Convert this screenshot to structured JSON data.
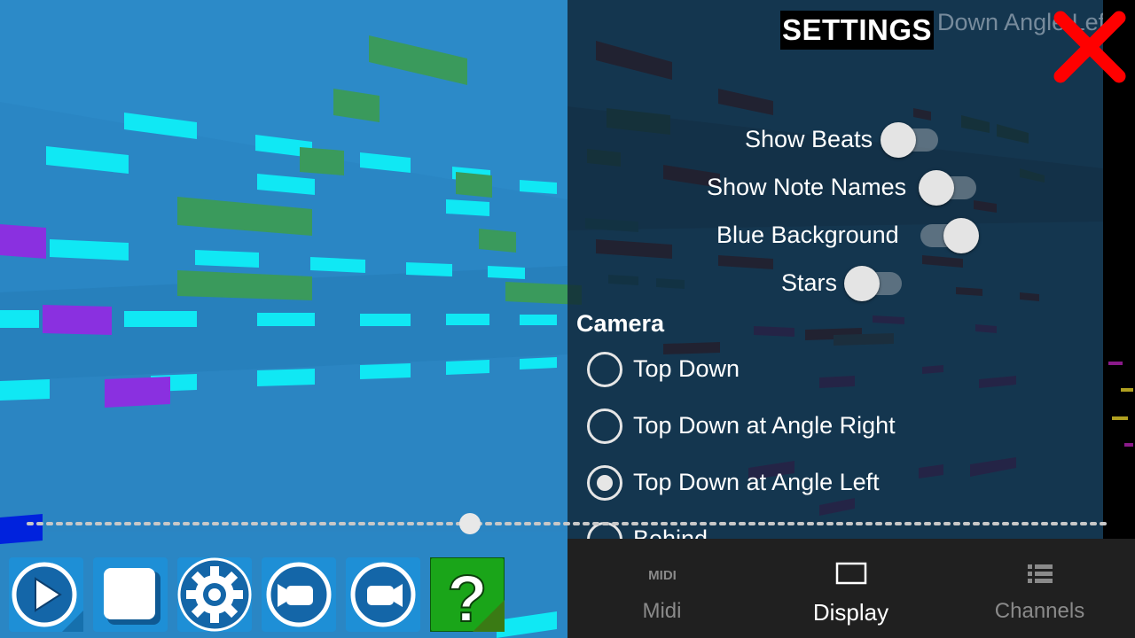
{
  "settings": {
    "title": "SETTINGS",
    "ghost_camera_text": "Top Down Angle Left",
    "close_color": "#ff0000",
    "toggles": [
      {
        "label": "Show Beats",
        "on": false
      },
      {
        "label": "Show Note Names",
        "on": false
      },
      {
        "label": "Blue Background",
        "on": true
      },
      {
        "label": "Stars",
        "on": false
      }
    ],
    "camera": {
      "heading": "Camera",
      "options": [
        {
          "label": "Top Down",
          "selected": false
        },
        {
          "label": "Top Down at Angle Right",
          "selected": false
        },
        {
          "label": "Top Down at Angle Left",
          "selected": true
        },
        {
          "label": "Behind",
          "selected": false
        }
      ]
    }
  },
  "playback": {
    "progress": 0.41
  },
  "toolbar": {
    "buttons": [
      {
        "name": "play-button",
        "icon": "play-icon",
        "color": "#1e8fd6"
      },
      {
        "name": "stop-button",
        "icon": "stop-icon",
        "color": "#1e8fd6"
      },
      {
        "name": "settings-button",
        "icon": "gear-icon",
        "color": "#1e8fd6"
      },
      {
        "name": "camera-prev-button",
        "icon": "camera-icon",
        "color": "#1e8fd6"
      },
      {
        "name": "camera-next-button",
        "icon": "camera-icon",
        "color": "#1e8fd6"
      },
      {
        "name": "help-button",
        "icon": "question-icon",
        "color": "#1aa519"
      }
    ]
  },
  "bottom_nav": {
    "tabs": [
      {
        "label": "Midi",
        "icon": "midi-icon",
        "active": false
      },
      {
        "label": "Display",
        "icon": "display-icon",
        "active": true
      },
      {
        "label": "Channels",
        "icon": "list-icon",
        "active": false
      }
    ]
  },
  "colors": {
    "background": "#2a86c4",
    "note_cyan": "#10e8f4",
    "note_green": "#3a9a5c",
    "note_purple": "#8a30e0",
    "note_dark_red": "#7a0a0a",
    "note_magenta": "#b010b0"
  }
}
